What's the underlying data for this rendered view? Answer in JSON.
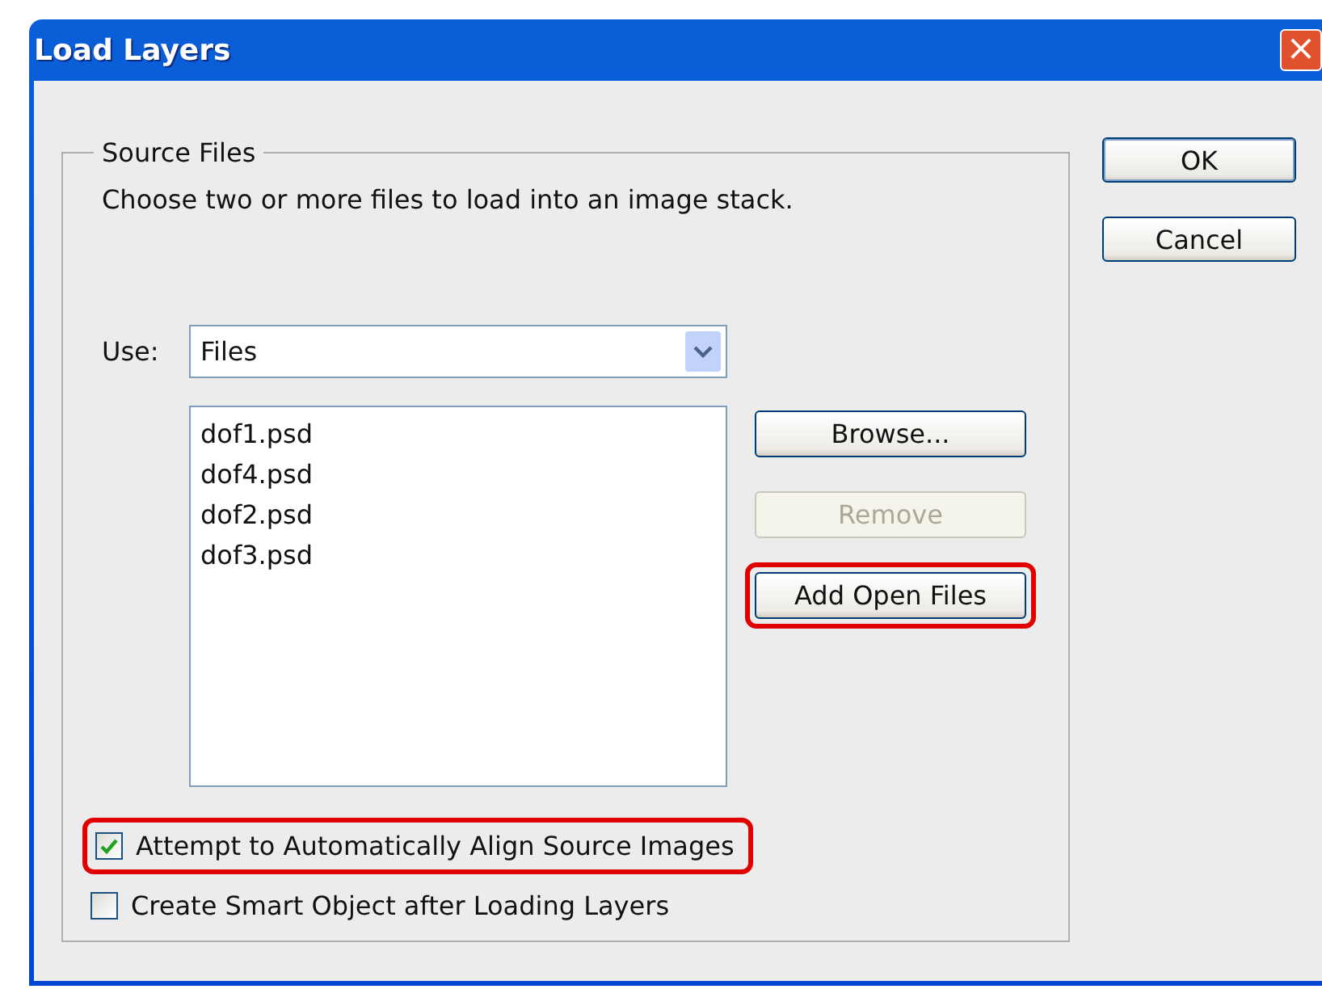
{
  "window": {
    "title": "Load Layers",
    "close": "×"
  },
  "source_files": {
    "legend": "Source Files",
    "description": "Choose two or more files to load into an image stack.",
    "use": {
      "label": "Use:",
      "value": "Files"
    },
    "files": [
      {
        "name": "dof1.psd",
        "selected": false
      },
      {
        "name": "dof4.psd",
        "selected": false
      },
      {
        "name": "dof2.psd",
        "selected": false
      },
      {
        "name": "dof3.psd",
        "selected": false
      }
    ],
    "file_buttons": [
      {
        "label": "Browse...",
        "disabled": false,
        "highlighted": false
      },
      {
        "label": "Remove",
        "disabled": true,
        "highlighted": false
      },
      {
        "label": "Add Open Files",
        "disabled": false,
        "highlighted": true
      }
    ],
    "options": [
      {
        "label": "Attempt to Automatically Align Source Images",
        "checked": true,
        "highlighted": true
      },
      {
        "label": "Create Smart Object after Loading Layers",
        "checked": false,
        "highlighted": false
      }
    ]
  },
  "buttons": [
    {
      "label": "OK",
      "default": true
    },
    {
      "label": "Cancel",
      "default": false
    }
  ]
}
